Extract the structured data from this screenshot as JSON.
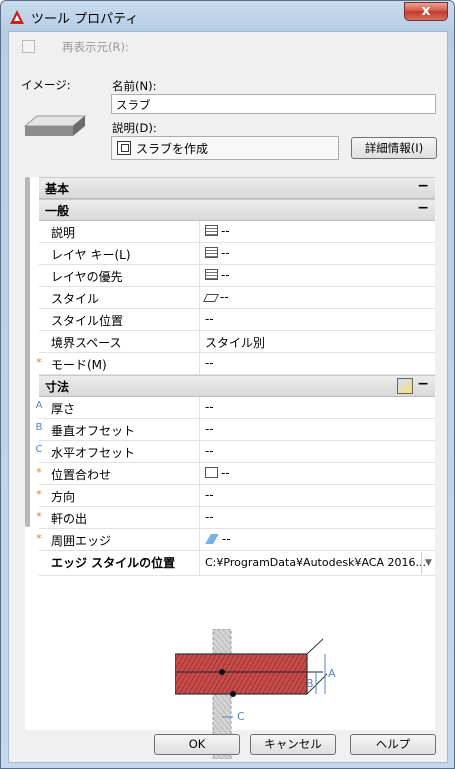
{
  "window": {
    "title": "ツール プロパティ",
    "close_glyph": "x"
  },
  "redisplay": {
    "label": "再表示元(R):"
  },
  "image_label": "イメージ:",
  "name": {
    "label": "名前(N):",
    "value": "スラブ"
  },
  "description": {
    "label": "説明(D):",
    "value": "スラブを作成",
    "detail_button": "詳細情報(I)"
  },
  "sections": {
    "basic": {
      "title": "基本",
      "toggle": "−"
    },
    "general": {
      "title": "一般",
      "toggle": "−"
    },
    "dimensions": {
      "title": "寸法",
      "toggle": "−"
    }
  },
  "general_rows": [
    {
      "name": "説明",
      "value": "--",
      "icon": "table-icon"
    },
    {
      "name": "レイヤ キー(L)",
      "value": "--",
      "icon": "table-icon"
    },
    {
      "name": "レイヤの優先",
      "value": "--",
      "icon": "table-icon"
    },
    {
      "name": "スタイル",
      "value": "--",
      "icon": "style-icon"
    },
    {
      "name": "スタイル位置",
      "value": "--"
    },
    {
      "name": "境界スペース",
      "value": "スタイル別"
    },
    {
      "name": "モード(M)",
      "value": "--",
      "mark": "*"
    }
  ],
  "dimension_rows": [
    {
      "name": "厚さ",
      "value": "--",
      "mark": "A"
    },
    {
      "name": "垂直オフセット",
      "value": "--",
      "mark": "B"
    },
    {
      "name": "水平オフセット",
      "value": "--",
      "mark": "C"
    },
    {
      "name": "位置合わせ",
      "value": "--",
      "mark": "*",
      "icon": "checkbox-icon"
    },
    {
      "name": "方向",
      "value": "--",
      "mark": "*"
    },
    {
      "name": "軒の出",
      "value": "--",
      "mark": "*"
    },
    {
      "name": "周囲エッジ",
      "value": "--",
      "mark": "*",
      "icon": "edge-icon"
    }
  ],
  "edge_style": {
    "name": "エッジ スタイルの位置",
    "value": "C:¥ProgramData¥Autodesk¥ACA 2016..."
  },
  "diagram_labels": {
    "a": "A",
    "b": "B",
    "c": "C"
  },
  "buttons": {
    "ok": "OK",
    "cancel": "キャンセル",
    "help": "ヘルプ"
  }
}
